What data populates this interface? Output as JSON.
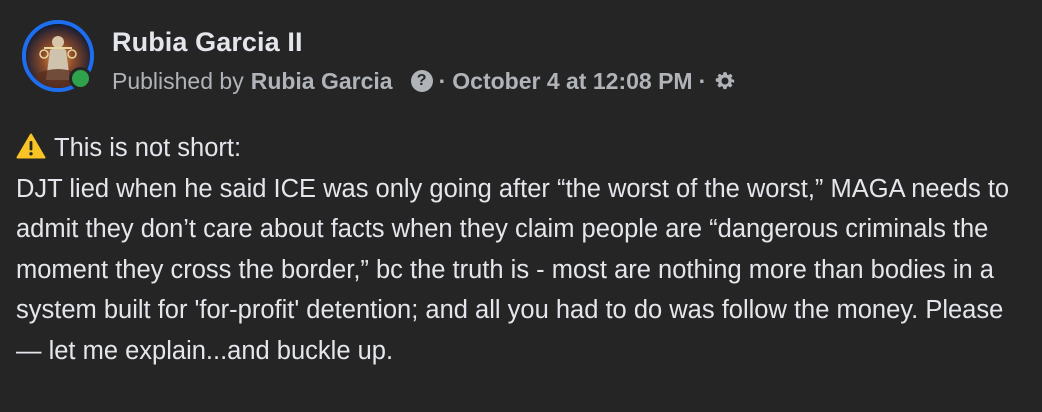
{
  "post": {
    "page_name": "Rubia Garcia II",
    "published_by_prefix": "Published by",
    "author": "Rubia Garcia",
    "help_icon_glyph": "?",
    "separator": "·",
    "date": "October 4 at 12:08 PM",
    "icons": {
      "avatar": "avatar-image",
      "online": "online-status-dot",
      "help": "question-circle-icon",
      "settings": "gear-icon",
      "warning": "warning-icon"
    },
    "colors": {
      "background": "#252526",
      "text": "#e4e6eb",
      "secondary_text": "#b0b3b8",
      "avatar_ring": "#1d6ff2",
      "online": "#31a24c",
      "warning": "#f7c325"
    },
    "body": {
      "heading": "This is not short:",
      "text": "DJT lied when he said ICE was only going after “the worst of the worst,” MAGA needs to admit they don’t care about facts when they claim people are “dangerous criminals the moment they cross the border,” bc the truth is - most are nothing more than bodies in a system built for 'for-profit' detention; and all you had to do was follow the money. Please — let me explain...and buckle up."
    }
  }
}
